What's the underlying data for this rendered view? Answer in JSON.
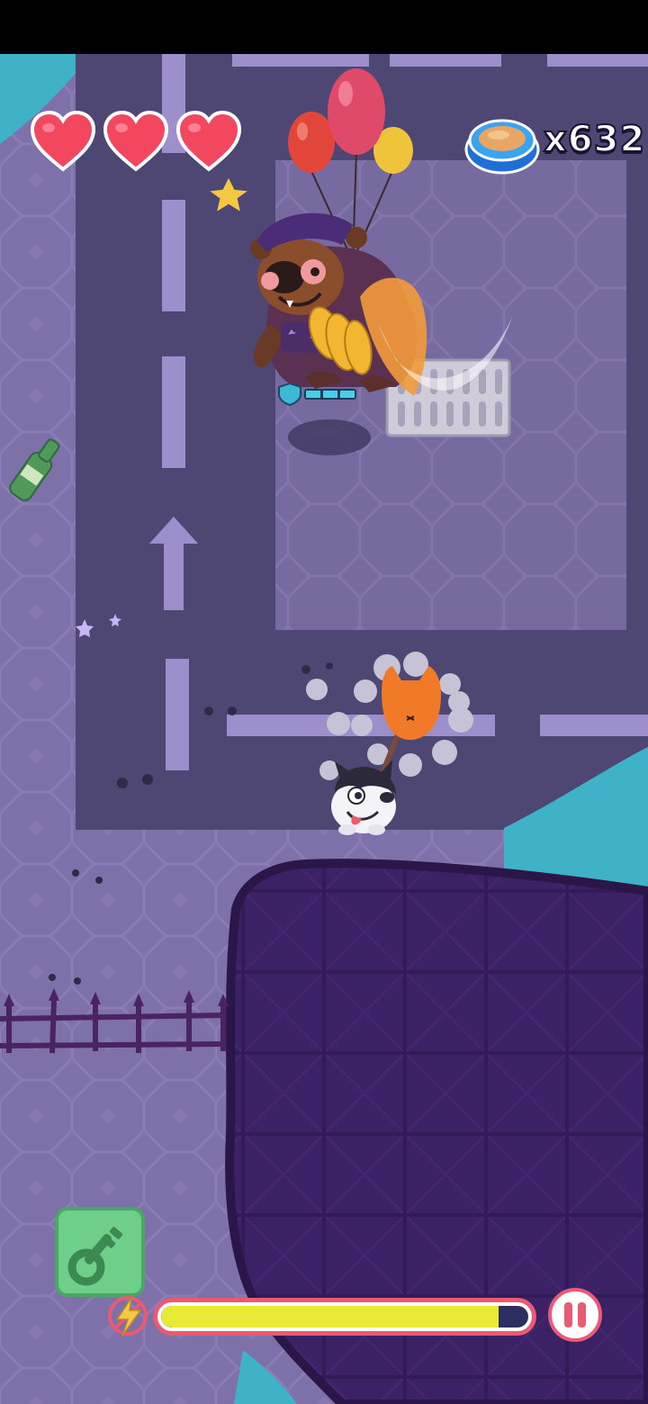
{
  "hud": {
    "lives": {
      "current": 3,
      "max": 3,
      "icon": "heart-icon",
      "color": "#f2475f"
    },
    "currency": {
      "icon": "food-bowl-icon",
      "count_label": "x632",
      "count": 632
    },
    "energy": {
      "icon": "lightning-bolt-icon",
      "level": 0.92,
      "fill_color": "#e9ea35",
      "border_color": "#ea5a72"
    },
    "key_button": {
      "icon": "key-icon",
      "color": "#6ecf8a"
    },
    "pause_button": {
      "icon": "pause-icon",
      "color": "#ea5a72"
    }
  },
  "scene": {
    "boss": {
      "name": "bear-police-boss",
      "shield_segments": 3,
      "balloons": [
        "red",
        "pink",
        "yellow"
      ]
    },
    "player": "husky-dog",
    "enemy": "orange-cat",
    "props": [
      "beer-bottle",
      "sewer-grate",
      "spiked-fence",
      "paw-prints",
      "dark-water-pit"
    ]
  }
}
